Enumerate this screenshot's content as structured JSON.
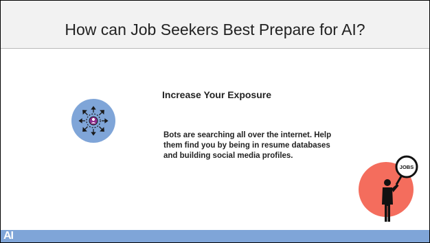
{
  "slide": {
    "title": "How can Job Seekers Best Prepare for AI?",
    "heading": "Increase Your Exposure",
    "body": "Bots are searching all over the internet.  Help them find you by being in resume databases and building social media profiles."
  },
  "icons": {
    "exposure": "person-arrows-outward-icon",
    "job_search": "person-magnifier-jobs-icon",
    "magnifier_label": "JOBS"
  },
  "footer": {
    "mark": "AI"
  },
  "colors": {
    "title_band": "#f2f2f2",
    "exposure_circle": "#7fa5d8",
    "jobs_circle": "#f46d5d",
    "footer_band": "#7fa5d8",
    "text": "#222222"
  }
}
